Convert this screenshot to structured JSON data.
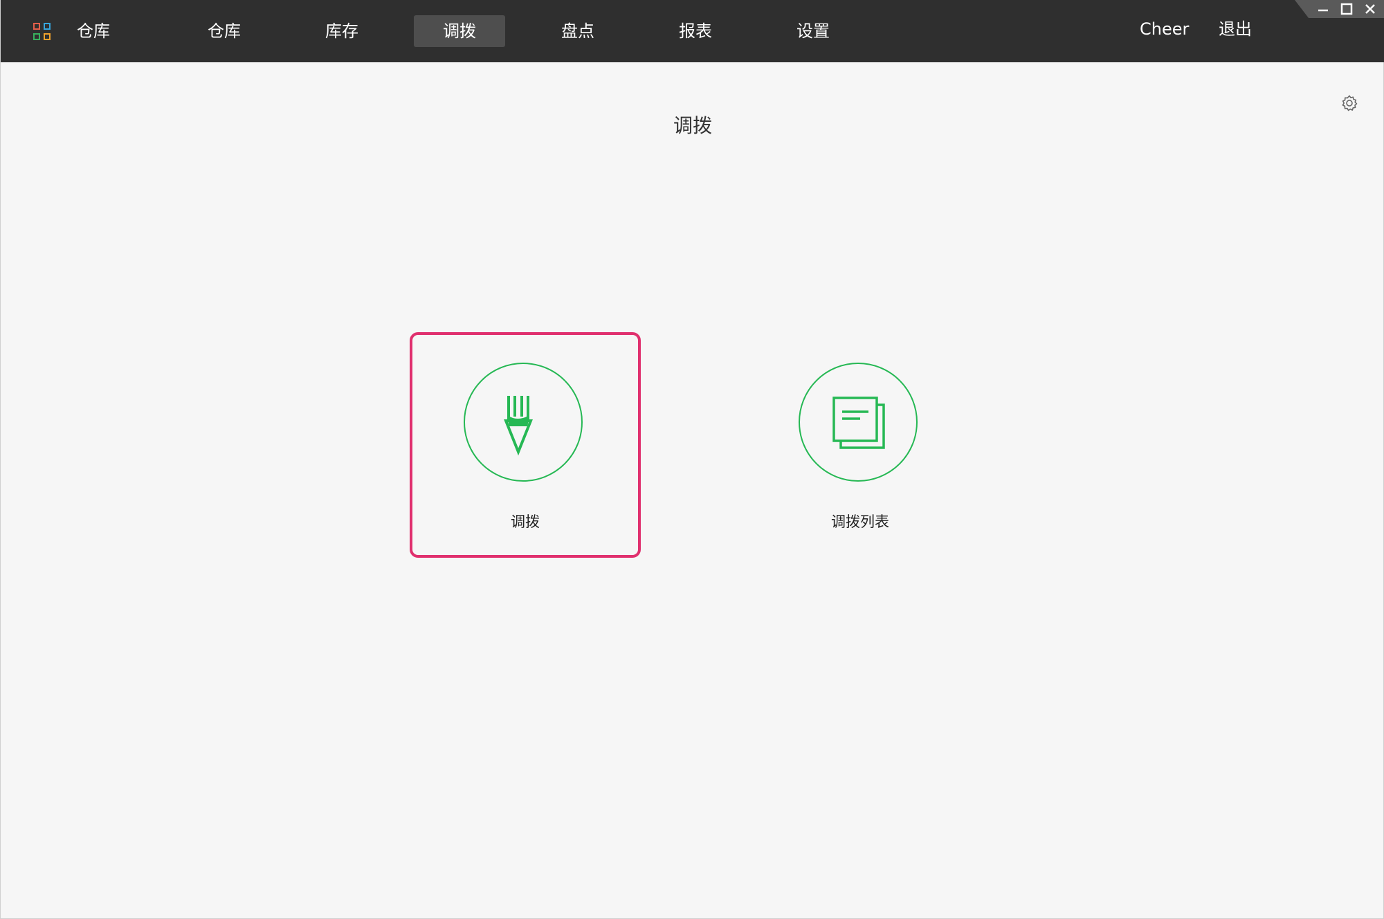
{
  "header": {
    "app_name": "仓库",
    "nav": [
      {
        "label": "仓库"
      },
      {
        "label": "库存"
      },
      {
        "label": "调拨",
        "active": true
      },
      {
        "label": "盘点"
      },
      {
        "label": "报表"
      },
      {
        "label": "设置"
      }
    ],
    "user": "Cheer",
    "logout_label": "退出"
  },
  "window_controls": [
    "minimize-icon",
    "maximize-icon",
    "close-icon"
  ],
  "main": {
    "title": "调拨",
    "tiles": [
      {
        "label": "调拨",
        "icon": "pencil-icon",
        "selected": true
      },
      {
        "label": "调拨列表",
        "icon": "document-list-icon",
        "selected": false
      }
    ]
  },
  "colors": {
    "topbar": "#2f2f2f",
    "active_nav": "#4e4e4e",
    "accent_green": "#26b854",
    "selection_pink": "#e0306e",
    "background": "#f6f6f6"
  }
}
